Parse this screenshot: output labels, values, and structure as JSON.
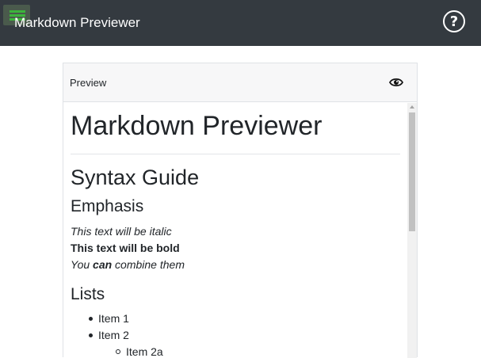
{
  "app": {
    "title": "Markdown Previewer"
  },
  "icons": {
    "menu": "hamburger-icon",
    "help": "question-circle-icon",
    "preview": "eye-icon"
  },
  "colors": {
    "navbar_bg": "#343a40",
    "card_header_bg": "#f7f7f8",
    "menu_highlight": "#3cb43c"
  },
  "preview_panel": {
    "header_label": "Preview",
    "content": {
      "h1": "Markdown Previewer",
      "h2": "Syntax Guide",
      "emphasis": {
        "heading": "Emphasis",
        "italic_line": "This text will be italic",
        "bold_line": "This text will be bold",
        "combined_prefix": "You",
        "combined_strong": "can",
        "combined_suffix": "combine them"
      },
      "lists": {
        "heading": "Lists",
        "items": [
          "Item 1",
          "Item 2"
        ],
        "subitems": [
          "Item 2a"
        ]
      }
    }
  },
  "help_button": {
    "glyph": "?"
  }
}
